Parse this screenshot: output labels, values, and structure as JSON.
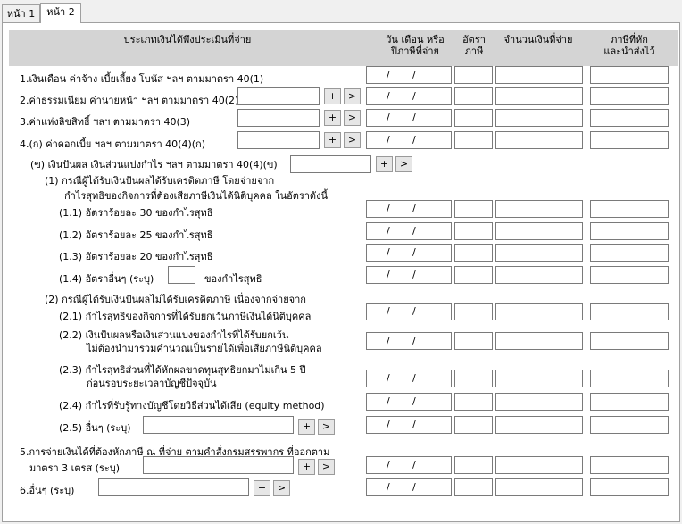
{
  "tabs": [
    "หน้า 1",
    "หน้า 2"
  ],
  "headers": {
    "type": "ประเภทเงินได้พึงประเมินที่จ่าย",
    "date_line1": "วัน เดือน หรือ",
    "date_line2": "ปีภาษีที่จ่าย",
    "rate_line1": "อัตรา",
    "rate_line2": "ภาษี",
    "amount": "จำนวนเงินที่จ่าย",
    "tax_line1": "ภาษีที่หัก",
    "tax_line2": "และนำส่งไว้"
  },
  "date_separator": "/",
  "buttons": {
    "add": "+",
    "next": ">"
  },
  "labels": {
    "r1": "1.เงินเดือน ค่าจ้าง เบี้ยเลี้ยง โบนัส ฯลฯ ตามมาตรา 40(1)",
    "r2": "2.ค่าธรรมเนียม ค่านายหน้า ฯลฯ ตามมาตรา 40(2)",
    "r3": "3.ค่าแห่งลิขสิทธิ์ ฯลฯ ตามมาตรา 40(3)",
    "r4a": "4.(ก) ค่าดอกเบี้ย ฯลฯ ตามมาตรา 40(4)(ก)",
    "r4b": "(ข) เงินปันผล เงินส่วนแบ่งกำไร ฯลฯ ตามมาตรา 40(4)(ข)",
    "r4b1_line1": "(1) กรณีผู้ได้รับเงินปันผลได้รับเครดิตภาษี โดยจ่ายจาก",
    "r4b1_line2": "กำไรสุทธิของกิจการที่ต้องเสียภาษีเงินได้นิติบุคคล ในอัตราดังนี้",
    "r4b11": "(1.1) อัตราร้อยละ 30 ของกำไรสุทธิ",
    "r4b12": "(1.2) อัตราร้อยละ 25 ของกำไรสุทธิ",
    "r4b13": "(1.3) อัตราร้อยละ 20 ของกำไรสุทธิ",
    "r4b14a": "(1.4) อัตราอื่นๆ (ระบุ)",
    "r4b14b": "ของกำไรสุทธิ",
    "r4b2": "(2) กรณีผู้ได้รับเงินปันผลไม่ได้รับเครดิตภาษี เนื่องจากจ่ายจาก",
    "r4b21": "(2.1) กำไรสุทธิของกิจการที่ได้รับยกเว้นภาษีเงินได้นิติบุคคล",
    "r4b22_line1": "(2.2) เงินปันผลหรือเงินส่วนแบ่งของกำไรที่ได้รับยกเว้น",
    "r4b22_line2": "ไม่ต้องนำมารวมคำนวณเป็นรายได้เพื่อเสียภาษีนิติบุคคล",
    "r4b23_line1": "(2.3) กำไรสุทธิส่วนที่ได้หักผลขาดทุนสุทธิยกมาไม่เกิน 5 ปี",
    "r4b23_line2": "ก่อนรอบระยะเวลาบัญชีปัจจุบัน",
    "r4b24": "(2.4) กำไรที่รับรู้ทางบัญชีโดยวิธีส่วนได้เสีย (equity method)",
    "r4b25": "(2.5) อื่นๆ (ระบุ)",
    "r5_line1": "5.การจ่ายเงินได้ที่ต้องหักภาษี ณ ที่จ่าย ตามคำสั่งกรมสรรพากร ที่ออกตาม",
    "r5_line2": "มาตรา 3 เตรส (ระบุ)",
    "r6": "6.อื่นๆ (ระบุ)"
  }
}
